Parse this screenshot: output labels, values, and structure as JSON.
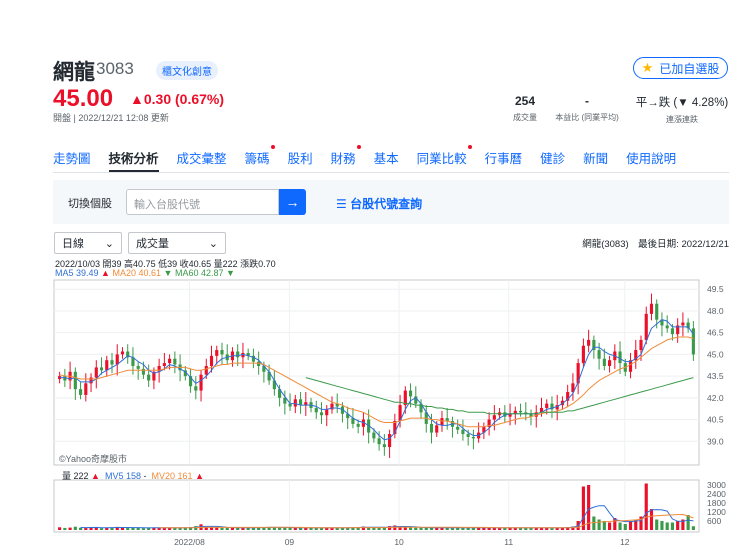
{
  "stock": {
    "name": "網龍",
    "code": "3083",
    "tag": "櫃文化創意",
    "price": "45.00",
    "change": "▲0.30 (0.67%)",
    "update": "開盤 | 2022/12/21 12:08 更新",
    "follow_label": "已加自選股"
  },
  "stats": [
    {
      "value": "254",
      "label": "成交量"
    },
    {
      "value": "-",
      "label": "本益比 (同業平均)"
    },
    {
      "value": "平→跌 (▼ 4.28%)",
      "label": "連漲連跌"
    }
  ],
  "nav": [
    {
      "label": "走勢圖",
      "dot": false,
      "active": false
    },
    {
      "label": "技術分析",
      "dot": false,
      "active": true
    },
    {
      "label": "成交彙整",
      "dot": false,
      "active": false
    },
    {
      "label": "籌碼",
      "dot": true,
      "active": false
    },
    {
      "label": "股利",
      "dot": false,
      "active": false
    },
    {
      "label": "財務",
      "dot": true,
      "active": false
    },
    {
      "label": "基本",
      "dot": false,
      "active": false
    },
    {
      "label": "同業比較",
      "dot": true,
      "active": false
    },
    {
      "label": "行事曆",
      "dot": false,
      "active": false
    },
    {
      "label": "健診",
      "dot": false,
      "active": false
    },
    {
      "label": "新聞",
      "dot": false,
      "active": false
    },
    {
      "label": "使用說明",
      "dot": false,
      "active": false
    }
  ],
  "switcher": {
    "label": "切換個股",
    "placeholder": "輸入台股代號",
    "link": "台股代號查詢"
  },
  "selects": {
    "period": "日線",
    "indicator": "成交量"
  },
  "chart_info": {
    "right": "網龍(3083)　最後日期: 2022/12/21",
    "ohlc": "2022/10/03 開39 高40.75 低39 收40.65 量222 漲跌0.70",
    "ma5": "MA5 39.49",
    "ma20": "MA20 40.61",
    "ma60": "MA60 42.87",
    "watermark": "©Yahoo奇摩股市",
    "vol_total": "量 222",
    "mv5": "MV5 158",
    "mv20": "MV20 161"
  },
  "colors": {
    "up": "#eb0f29",
    "down": "#3a9a4a",
    "accent": "#0f69ff",
    "ma5": "#2f6fd8",
    "ma20": "#f08b3a",
    "ma60": "#3a9a4a"
  },
  "chart_data": {
    "type": "candlestick",
    "price_ticks": [
      49.5,
      48.0,
      46.5,
      45.0,
      43.5,
      42.0,
      40.5,
      39.0
    ],
    "volume_ticks": [
      3000,
      2400,
      1800,
      1200,
      600
    ],
    "x_ticks": [
      "2022/08",
      "09",
      "10",
      "11",
      "12"
    ],
    "close": [
      43.5,
      43.2,
      43.8,
      42.6,
      42.2,
      43.0,
      43.4,
      44.1,
      43.9,
      44.6,
      44.3,
      45.0,
      45.2,
      44.8,
      44.2,
      44.0,
      43.6,
      43.2,
      43.8,
      44.2,
      44.4,
      44.7,
      44.3,
      43.9,
      43.5,
      42.8,
      42.5,
      43.6,
      44.2,
      44.9,
      45.3,
      45.0,
      44.6,
      45.2,
      44.8,
      45.1,
      44.9,
      44.5,
      44.2,
      43.8,
      43.2,
      42.6,
      42.0,
      41.6,
      41.4,
      41.9,
      41.5,
      41.7,
      41.3,
      41.0,
      40.8,
      41.2,
      41.6,
      41.4,
      40.9,
      40.6,
      40.2,
      40.0,
      40.5,
      39.6,
      39.2,
      38.8,
      38.6,
      39.5,
      40.4,
      41.5,
      42.5,
      42.1,
      41.6,
      41.0,
      40.2,
      39.6,
      40.1,
      40.6,
      40.4,
      40.0,
      39.8,
      39.5,
      39.3,
      39.2,
      39.6,
      40.0,
      40.5,
      40.8,
      41.0,
      40.7,
      40.9,
      41.1,
      41.0,
      40.9,
      40.7,
      41.0,
      41.3,
      41.6,
      41.2,
      41.5,
      41.8,
      42.4,
      43.0,
      44.4,
      45.6,
      46.0,
      45.3,
      44.7,
      44.2,
      44.6,
      45.2,
      44.4,
      43.8,
      44.6,
      45.3,
      46.0,
      47.8,
      48.5,
      47.4,
      47.0,
      46.8,
      46.4,
      47.0,
      47.2,
      46.8,
      45.0
    ],
    "volume": [
      180,
      140,
      160,
      220,
      150,
      130,
      170,
      190,
      120,
      160,
      150,
      210,
      180,
      130,
      140,
      150,
      120,
      170,
      160,
      140,
      130,
      150,
      160,
      140,
      170,
      190,
      260,
      380,
      200,
      180,
      170,
      150,
      160,
      140,
      150,
      130,
      160,
      170,
      180,
      150,
      200,
      170,
      160,
      140,
      150,
      130,
      160,
      170,
      150,
      140,
      130,
      150,
      160,
      140,
      150,
      170,
      180,
      190,
      230,
      150,
      160,
      180,
      200,
      260,
      300,
      210,
      180,
      170,
      160,
      150,
      140,
      150,
      160,
      150,
      140,
      130,
      150,
      160,
      140,
      150,
      170,
      160,
      150,
      140,
      130,
      150,
      160,
      140,
      150,
      170,
      160,
      150,
      140,
      130,
      150,
      160,
      170,
      200,
      230,
      600,
      2900,
      3000,
      900,
      700,
      600,
      500,
      800,
      500,
      400,
      600,
      700,
      900,
      3100,
      1400,
      700,
      600,
      500,
      500,
      600,
      700,
      1000,
      250
    ],
    "ma5": [
      43.4,
      43.4,
      43.3,
      43.4,
      43.1,
      43.1,
      43.1,
      43.3,
      43.7,
      43.9,
      44.1,
      44.3,
      44.6,
      44.9,
      44.8,
      44.5,
      44.3,
      43.9,
      43.7,
      43.8,
      44.0,
      44.3,
      44.2,
      44.0,
      43.8,
      43.4,
      43.0,
      43.2,
      43.5,
      43.9,
      44.4,
      44.7,
      44.8,
      44.9,
      44.9,
      45.0,
      44.9,
      44.8,
      44.6,
      44.2,
      43.8,
      43.2,
      42.6,
      42.1,
      41.6,
      41.6,
      41.5,
      41.5,
      41.5,
      41.4,
      41.2,
      41.2,
      41.3,
      41.3,
      41.2,
      40.9,
      40.6,
      40.4,
      40.3,
      40.1,
      39.8,
      39.4,
      39.1,
      39.2,
      39.6,
      40.4,
      41.2,
      41.8,
      42.0,
      41.6,
      41.0,
      40.5,
      40.2,
      40.1,
      40.1,
      40.2,
      40.2,
      39.9,
      39.6,
      39.4,
      39.4,
      39.6,
      39.9,
      40.3,
      40.6,
      40.8,
      40.9,
      40.9,
      40.9,
      40.9,
      40.9,
      40.9,
      41.0,
      41.2,
      41.3,
      41.4,
      41.6,
      41.9,
      42.3,
      43.1,
      44.1,
      45.0,
      45.5,
      45.5,
      45.2,
      45.0,
      44.9,
      44.7,
      44.5,
      44.5,
      44.7,
      45.0,
      45.9,
      46.8,
      47.1,
      47.4,
      47.3,
      46.9,
      46.9,
      46.9,
      46.9,
      46.4
    ],
    "ma20": [
      43.6,
      43.5,
      43.5,
      43.4,
      43.3,
      43.3,
      43.3,
      43.3,
      43.4,
      43.5,
      43.6,
      43.7,
      43.8,
      43.9,
      43.9,
      43.9,
      43.9,
      43.9,
      43.9,
      43.9,
      44.0,
      44.1,
      44.1,
      44.1,
      44.1,
      44.0,
      43.9,
      43.9,
      44.0,
      44.1,
      44.2,
      44.3,
      44.3,
      44.4,
      44.4,
      44.4,
      44.4,
      44.4,
      44.4,
      44.3,
      44.1,
      43.9,
      43.7,
      43.5,
      43.3,
      43.1,
      42.9,
      42.7,
      42.5,
      42.3,
      42.1,
      41.9,
      41.7,
      41.6,
      41.5,
      41.3,
      41.2,
      41.1,
      41.0,
      40.8,
      40.6,
      40.4,
      40.3,
      40.3,
      40.3,
      40.4,
      40.5,
      40.6,
      40.6,
      40.6,
      40.6,
      40.5,
      40.5,
      40.4,
      40.4,
      40.3,
      40.2,
      40.1,
      40.0,
      40.0,
      40.0,
      40.0,
      40.1,
      40.1,
      40.2,
      40.3,
      40.4,
      40.5,
      40.6,
      40.6,
      40.7,
      40.8,
      40.9,
      41.0,
      41.0,
      41.1,
      41.2,
      41.4,
      41.6,
      41.9,
      42.2,
      42.6,
      42.9,
      43.2,
      43.4,
      43.6,
      43.8,
      44.0,
      44.1,
      44.3,
      44.5,
      44.8,
      45.1,
      45.4,
      45.6,
      45.8,
      46.0,
      46.1,
      46.2,
      46.2,
      46.2,
      46.1
    ],
    "ma60": [
      null,
      null,
      null,
      null,
      null,
      null,
      null,
      null,
      null,
      null,
      null,
      null,
      null,
      null,
      null,
      null,
      null,
      null,
      null,
      null,
      null,
      null,
      null,
      null,
      null,
      null,
      null,
      null,
      null,
      null,
      null,
      null,
      null,
      null,
      null,
      null,
      null,
      null,
      null,
      null,
      null,
      null,
      null,
      null,
      null,
      null,
      null,
      43.4,
      43.3,
      43.2,
      43.1,
      43.0,
      42.9,
      42.8,
      42.7,
      42.6,
      42.5,
      42.4,
      42.3,
      42.2,
      42.1,
      42.0,
      41.9,
      41.8,
      41.7,
      41.7,
      41.6,
      41.6,
      41.5,
      41.5,
      41.4,
      41.4,
      41.3,
      41.3,
      41.2,
      41.2,
      41.1,
      41.1,
      41.0,
      41.0,
      41.0,
      41.0,
      40.9,
      40.9,
      40.9,
      40.9,
      40.9,
      40.9,
      40.9,
      40.9,
      40.9,
      40.9,
      41.0,
      41.0,
      41.0,
      41.0,
      41.0,
      41.1,
      41.1,
      41.2,
      41.3,
      41.4,
      41.5,
      41.6,
      41.7,
      41.8,
      41.9,
      42.0,
      42.1,
      42.2,
      42.3,
      42.4,
      42.5,
      42.6,
      42.7,
      42.8,
      42.9,
      43.0,
      43.1,
      43.2,
      43.3,
      43.4
    ]
  }
}
